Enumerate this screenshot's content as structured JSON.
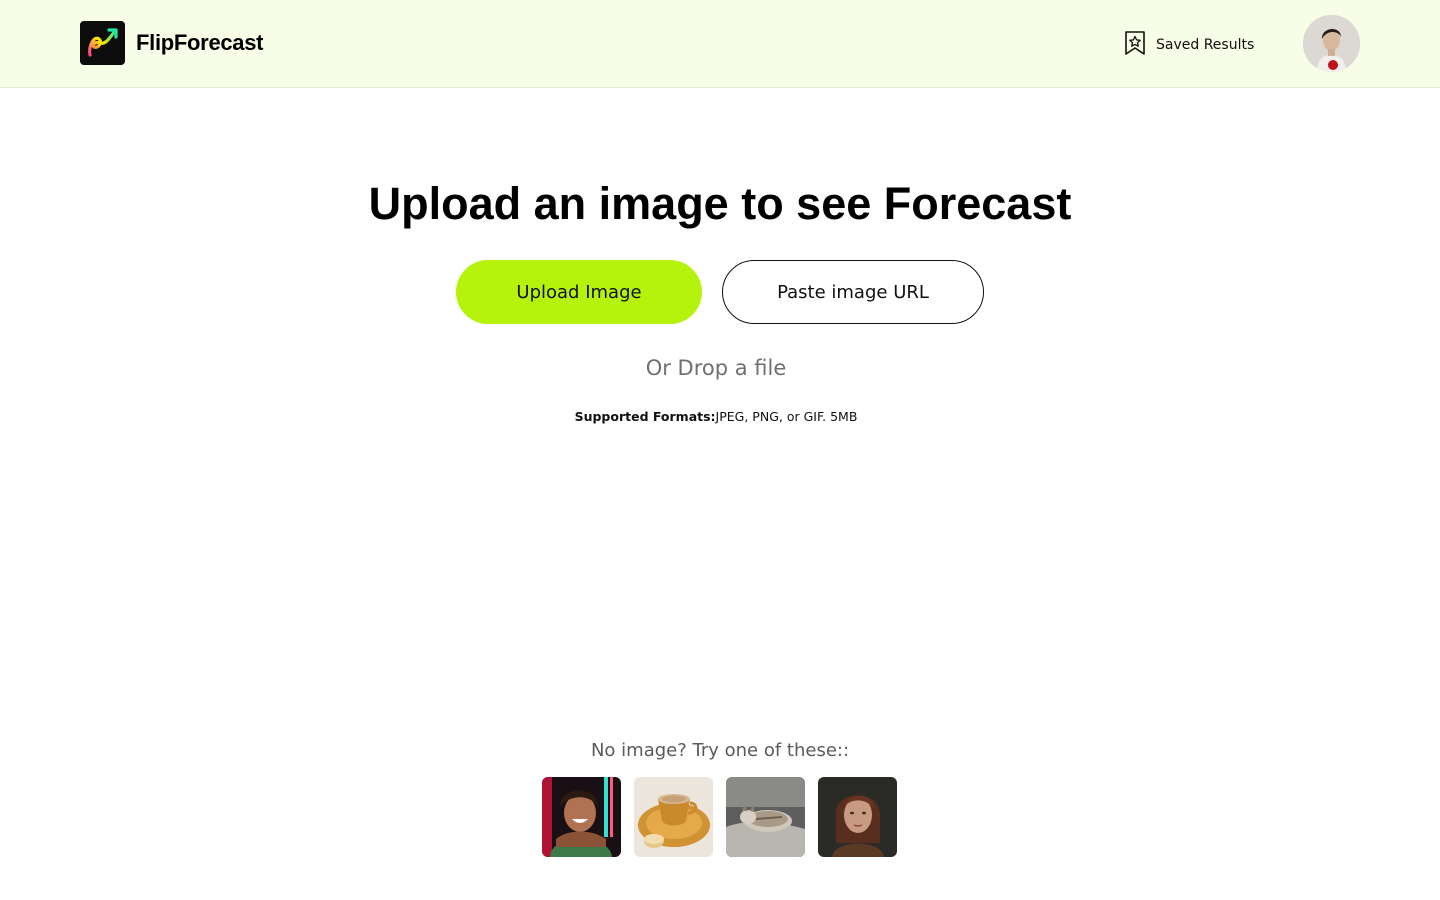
{
  "header": {
    "brand_name": "FlipForecast",
    "saved_label": "Saved Results"
  },
  "main": {
    "title": "Upload an image to see Forecast",
    "upload_button": "Upload Image",
    "url_button": "Paste image URL",
    "drop_text": "Or Drop a file",
    "formats_label": "Supported Formats:",
    "formats_value": "JPEG, PNG, or GIF. 5MB"
  },
  "samples": {
    "prompt": "No image? Try one of these::",
    "items": [
      {
        "name": "sample-image-smiling-woman"
      },
      {
        "name": "sample-image-coffee-cup"
      },
      {
        "name": "sample-image-sleeping-cat"
      },
      {
        "name": "sample-image-woman-portrait"
      }
    ]
  },
  "colors": {
    "header_bg": "#f7fde6",
    "accent": "#b5f20c",
    "logo_gradient": [
      "#ff3b8a",
      "#ffe600",
      "#21e6a0"
    ]
  },
  "icons": {
    "logo": "trend-arrow-logo-icon",
    "saved": "bookmark-star-icon"
  }
}
